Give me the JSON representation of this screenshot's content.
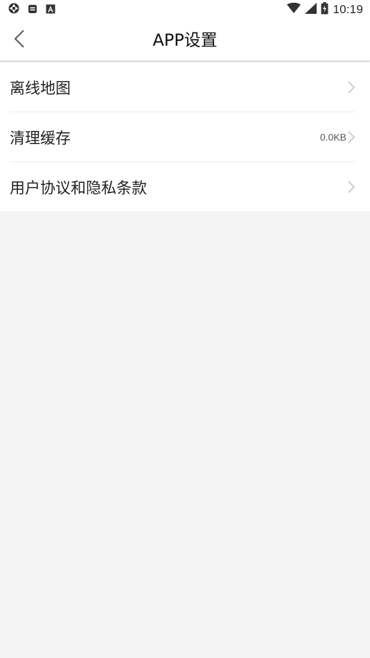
{
  "status_bar": {
    "time": "10:19",
    "left_icons": [
      "aperture-icon",
      "message-icon",
      "font-a-icon"
    ],
    "right_icons": [
      "wifi-icon",
      "signal-icon",
      "battery-icon"
    ]
  },
  "header": {
    "title": "APP设置",
    "back_icon": "chevron-left-icon"
  },
  "menu": {
    "items": [
      {
        "label": "离线地图",
        "value": ""
      },
      {
        "label": "清理缓存",
        "value": "0.0KB"
      },
      {
        "label": "用户协议和隐私条款",
        "value": ""
      }
    ]
  },
  "colors": {
    "background": "#f4f4f4",
    "surface": "#ffffff",
    "text": "#222222",
    "chevron": "#bbbbbb"
  }
}
